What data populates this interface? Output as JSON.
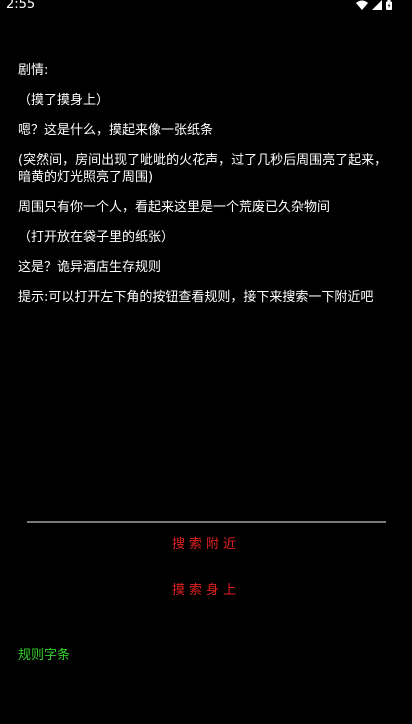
{
  "status_bar": {
    "time": "2:55",
    "icons": [
      "wifi-icon",
      "signal-icon",
      "battery-icon"
    ]
  },
  "story": {
    "lines": [
      "剧情:",
      "（摸了摸身上）",
      "嗯？这是什么，摸起来像一张纸条",
      "(突然间，房间出现了呲呲的火花声，过了几秒后周围亮了起来，暗黄的灯光照亮了周围)",
      "周围只有你一个人，看起来这里是一个荒废已久杂物间",
      "（打开放在袋子里的纸张）",
      "这是？诡异酒店生存规则",
      "提示:可以打开左下角的按钮查看规则，接下来搜索一下附近吧"
    ]
  },
  "actions": {
    "search_nearby": "搜索附近",
    "search_body": "摸索身上"
  },
  "rules_button": "规则字条",
  "colors": {
    "background": "#000000",
    "text": "#ffffff",
    "action": "#e02020",
    "rules": "#34d12c",
    "divider": "#7a7a7a"
  }
}
